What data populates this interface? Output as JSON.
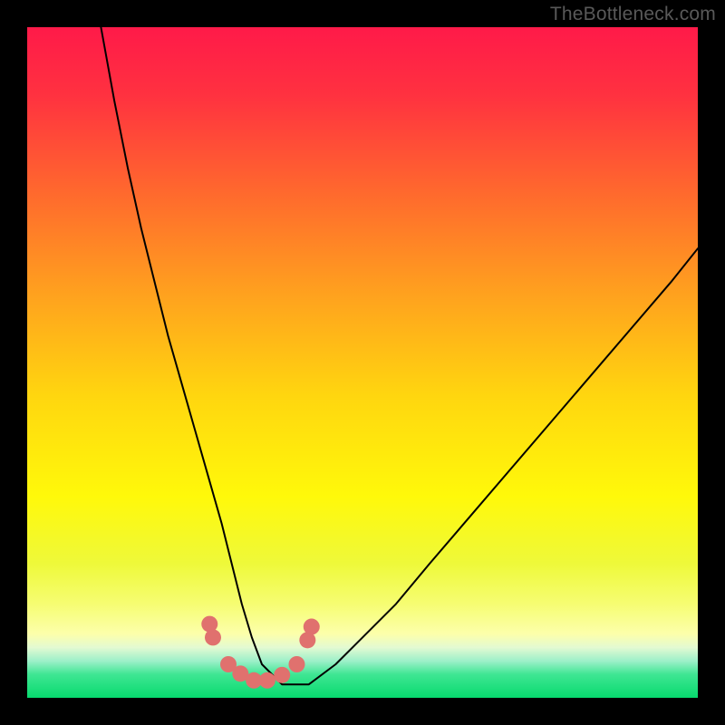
{
  "watermark": "TheBottleneck.com",
  "chart_data": {
    "type": "line",
    "title": "",
    "xlabel": "",
    "ylabel": "",
    "xlim": [
      0,
      100
    ],
    "ylim": [
      0,
      100
    ],
    "background_gradient_stops": [
      {
        "offset": 0.0,
        "color": "#ff1a49"
      },
      {
        "offset": 0.1,
        "color": "#ff3140"
      },
      {
        "offset": 0.25,
        "color": "#ff6a2d"
      },
      {
        "offset": 0.4,
        "color": "#ffa21e"
      },
      {
        "offset": 0.55,
        "color": "#ffd60f"
      },
      {
        "offset": 0.7,
        "color": "#fff90a"
      },
      {
        "offset": 0.8,
        "color": "#eef93a"
      },
      {
        "offset": 0.86,
        "color": "#f6fd72"
      },
      {
        "offset": 0.905,
        "color": "#fcffab"
      },
      {
        "offset": 0.925,
        "color": "#e3fad2"
      },
      {
        "offset": 0.945,
        "color": "#9df0c9"
      },
      {
        "offset": 0.965,
        "color": "#3fe693"
      },
      {
        "offset": 1.0,
        "color": "#07da6e"
      }
    ],
    "series": [
      {
        "name": "bottleneck-curve",
        "type": "line",
        "color": "#000000",
        "stroke_width": 2,
        "x": [
          11,
          13,
          15,
          17,
          19,
          21,
          23,
          25,
          27,
          29,
          30.5,
          32,
          33.5,
          35,
          38,
          42,
          46,
          50,
          55,
          60,
          66,
          72,
          78,
          84,
          90,
          96,
          100
        ],
        "y": [
          100,
          89,
          79,
          70,
          62,
          54,
          47,
          40,
          33,
          26,
          20,
          14,
          9,
          5,
          2,
          2,
          5,
          9,
          14,
          20,
          27,
          34,
          41,
          48,
          55,
          62,
          67
        ]
      },
      {
        "name": "marker-dots",
        "type": "scatter",
        "color": "#e0716e",
        "radius": 9,
        "x": [
          27.2,
          27.7,
          30.0,
          31.8,
          33.8,
          35.8,
          38.0,
          40.2,
          41.8,
          42.4
        ],
        "y": [
          11.0,
          9.0,
          5.0,
          3.6,
          2.6,
          2.6,
          3.4,
          5.0,
          8.6,
          10.6
        ]
      }
    ]
  }
}
